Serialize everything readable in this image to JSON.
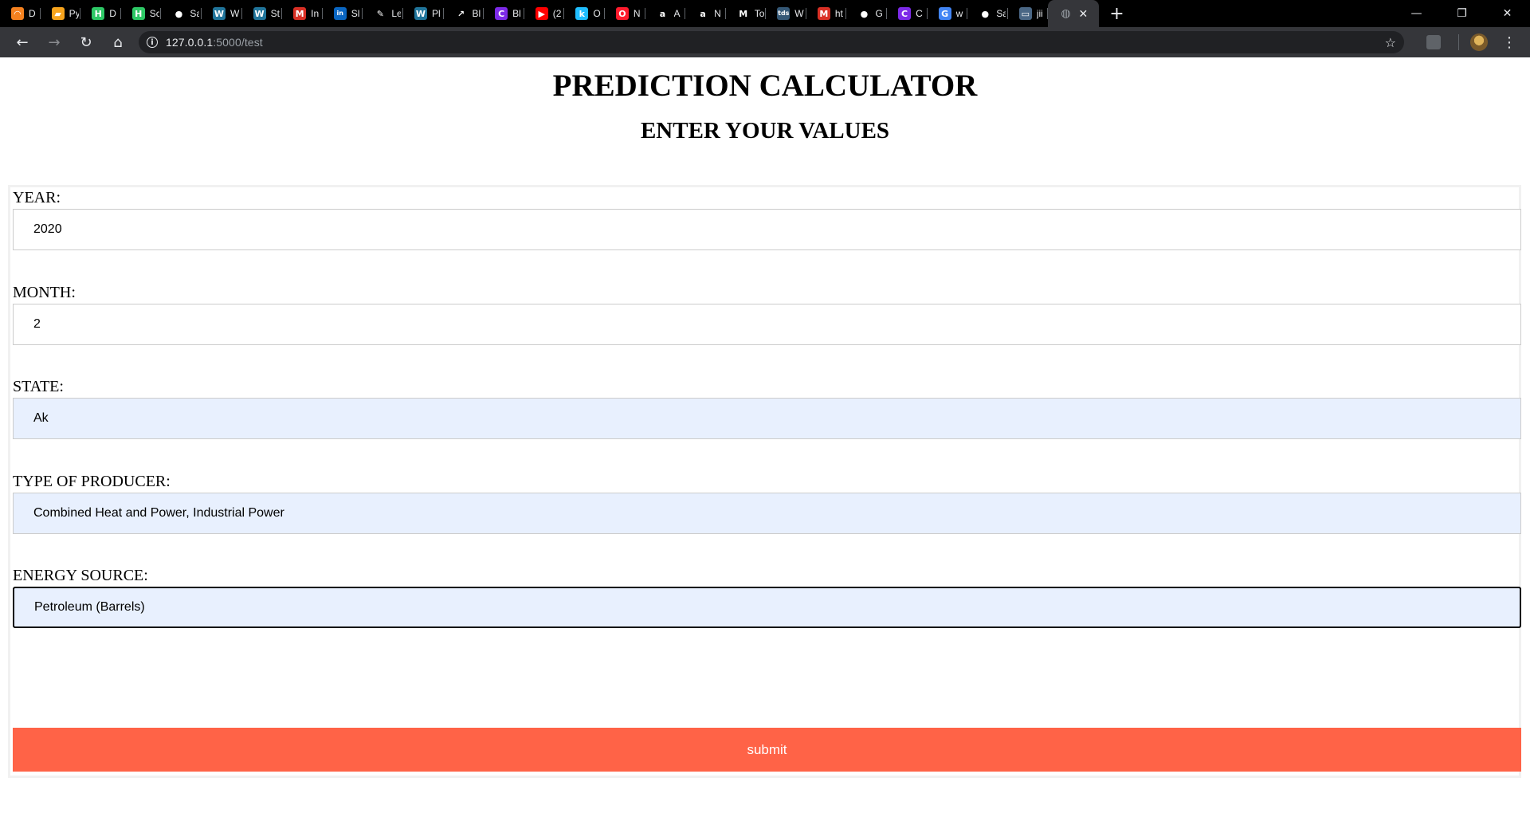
{
  "browser": {
    "tabs": [
      {
        "title": "D",
        "icon": "orange-swirl-icon",
        "color": "#f4811f",
        "glyph": "◠"
      },
      {
        "title": "Py",
        "icon": "notebook-icon",
        "color": "#f7a41d",
        "glyph": "▰"
      },
      {
        "title": "D",
        "icon": "hackerrank-icon",
        "color": "#2ec866",
        "glyph": "H"
      },
      {
        "title": "Sc",
        "icon": "hackerrank-icon",
        "color": "#2ec866",
        "glyph": "H"
      },
      {
        "title": "Sa",
        "icon": "github-icon",
        "color": "#ffffff",
        "glyph": "●"
      },
      {
        "title": "W",
        "icon": "wordpress-icon",
        "color": "#21759b",
        "glyph": "W"
      },
      {
        "title": "St",
        "icon": "wordpress-icon",
        "color": "#21759b",
        "glyph": "W"
      },
      {
        "title": "In",
        "icon": "gmail-icon",
        "color": "#d93025",
        "glyph": "M"
      },
      {
        "title": "Sl",
        "icon": "linkedin-icon",
        "color": "#0a66c2",
        "glyph": "in"
      },
      {
        "title": "Le",
        "icon": "pen-icon",
        "color": "#ffffff",
        "glyph": "✎"
      },
      {
        "title": "Pl",
        "icon": "wordpress-icon",
        "color": "#21759b",
        "glyph": "W"
      },
      {
        "title": "Bl",
        "icon": "chart-icon",
        "color": "#ffffff",
        "glyph": "↗"
      },
      {
        "title": "Bl",
        "icon": "canva-icon",
        "color": "#7d2ae8",
        "glyph": "C"
      },
      {
        "title": "(2",
        "icon": "youtube-icon",
        "color": "#ff0000",
        "glyph": "▶"
      },
      {
        "title": "O",
        "icon": "kaggle-icon",
        "color": "#20beff",
        "glyph": "k"
      },
      {
        "title": "N",
        "icon": "opera-icon",
        "color": "#ff1b2d",
        "glyph": "O"
      },
      {
        "title": "A",
        "icon": "amazon-icon",
        "color": "#ffffff",
        "glyph": "a"
      },
      {
        "title": "N",
        "icon": "amazon-icon",
        "color": "#ffffff",
        "glyph": "a"
      },
      {
        "title": "To",
        "icon": "medium-icon",
        "color": "#ffffff",
        "glyph": "M"
      },
      {
        "title": "W",
        "icon": "tds-icon",
        "color": "#355876",
        "glyph": "tds"
      },
      {
        "title": "ht",
        "icon": "gmail-icon",
        "color": "#d93025",
        "glyph": "M"
      },
      {
        "title": "G",
        "icon": "github-icon",
        "color": "#ffffff",
        "glyph": "●"
      },
      {
        "title": "C",
        "icon": "canva-icon",
        "color": "#7d2ae8",
        "glyph": "C"
      },
      {
        "title": "w",
        "icon": "google-icon",
        "color": "#4285f4",
        "glyph": "G"
      },
      {
        "title": "Sa",
        "icon": "github-icon",
        "color": "#ffffff",
        "glyph": "●"
      },
      {
        "title": "jii",
        "icon": "terminal-icon",
        "color": "#4a6785",
        "glyph": "▭"
      }
    ],
    "active_tab_icon": "globe-icon",
    "url_host": "127.0.0.1",
    "url_rest": ":5000/test"
  },
  "page": {
    "title": "PREDICTION CALCULATOR",
    "subtitle": "ENTER YOUR VALUES",
    "fields": [
      {
        "label": "YEAR:",
        "value": "2020"
      },
      {
        "label": "MONTH:",
        "value": "2"
      },
      {
        "label": "STATE:",
        "value": "Ak"
      },
      {
        "label": "TYPE OF PRODUCER:",
        "value": "Combined Heat and Power, Industrial Power"
      },
      {
        "label": "ENERGY SOURCE:",
        "value": "Petroleum (Barrels)"
      }
    ],
    "submit_label": "submit",
    "accent_color": "#ff6347"
  }
}
